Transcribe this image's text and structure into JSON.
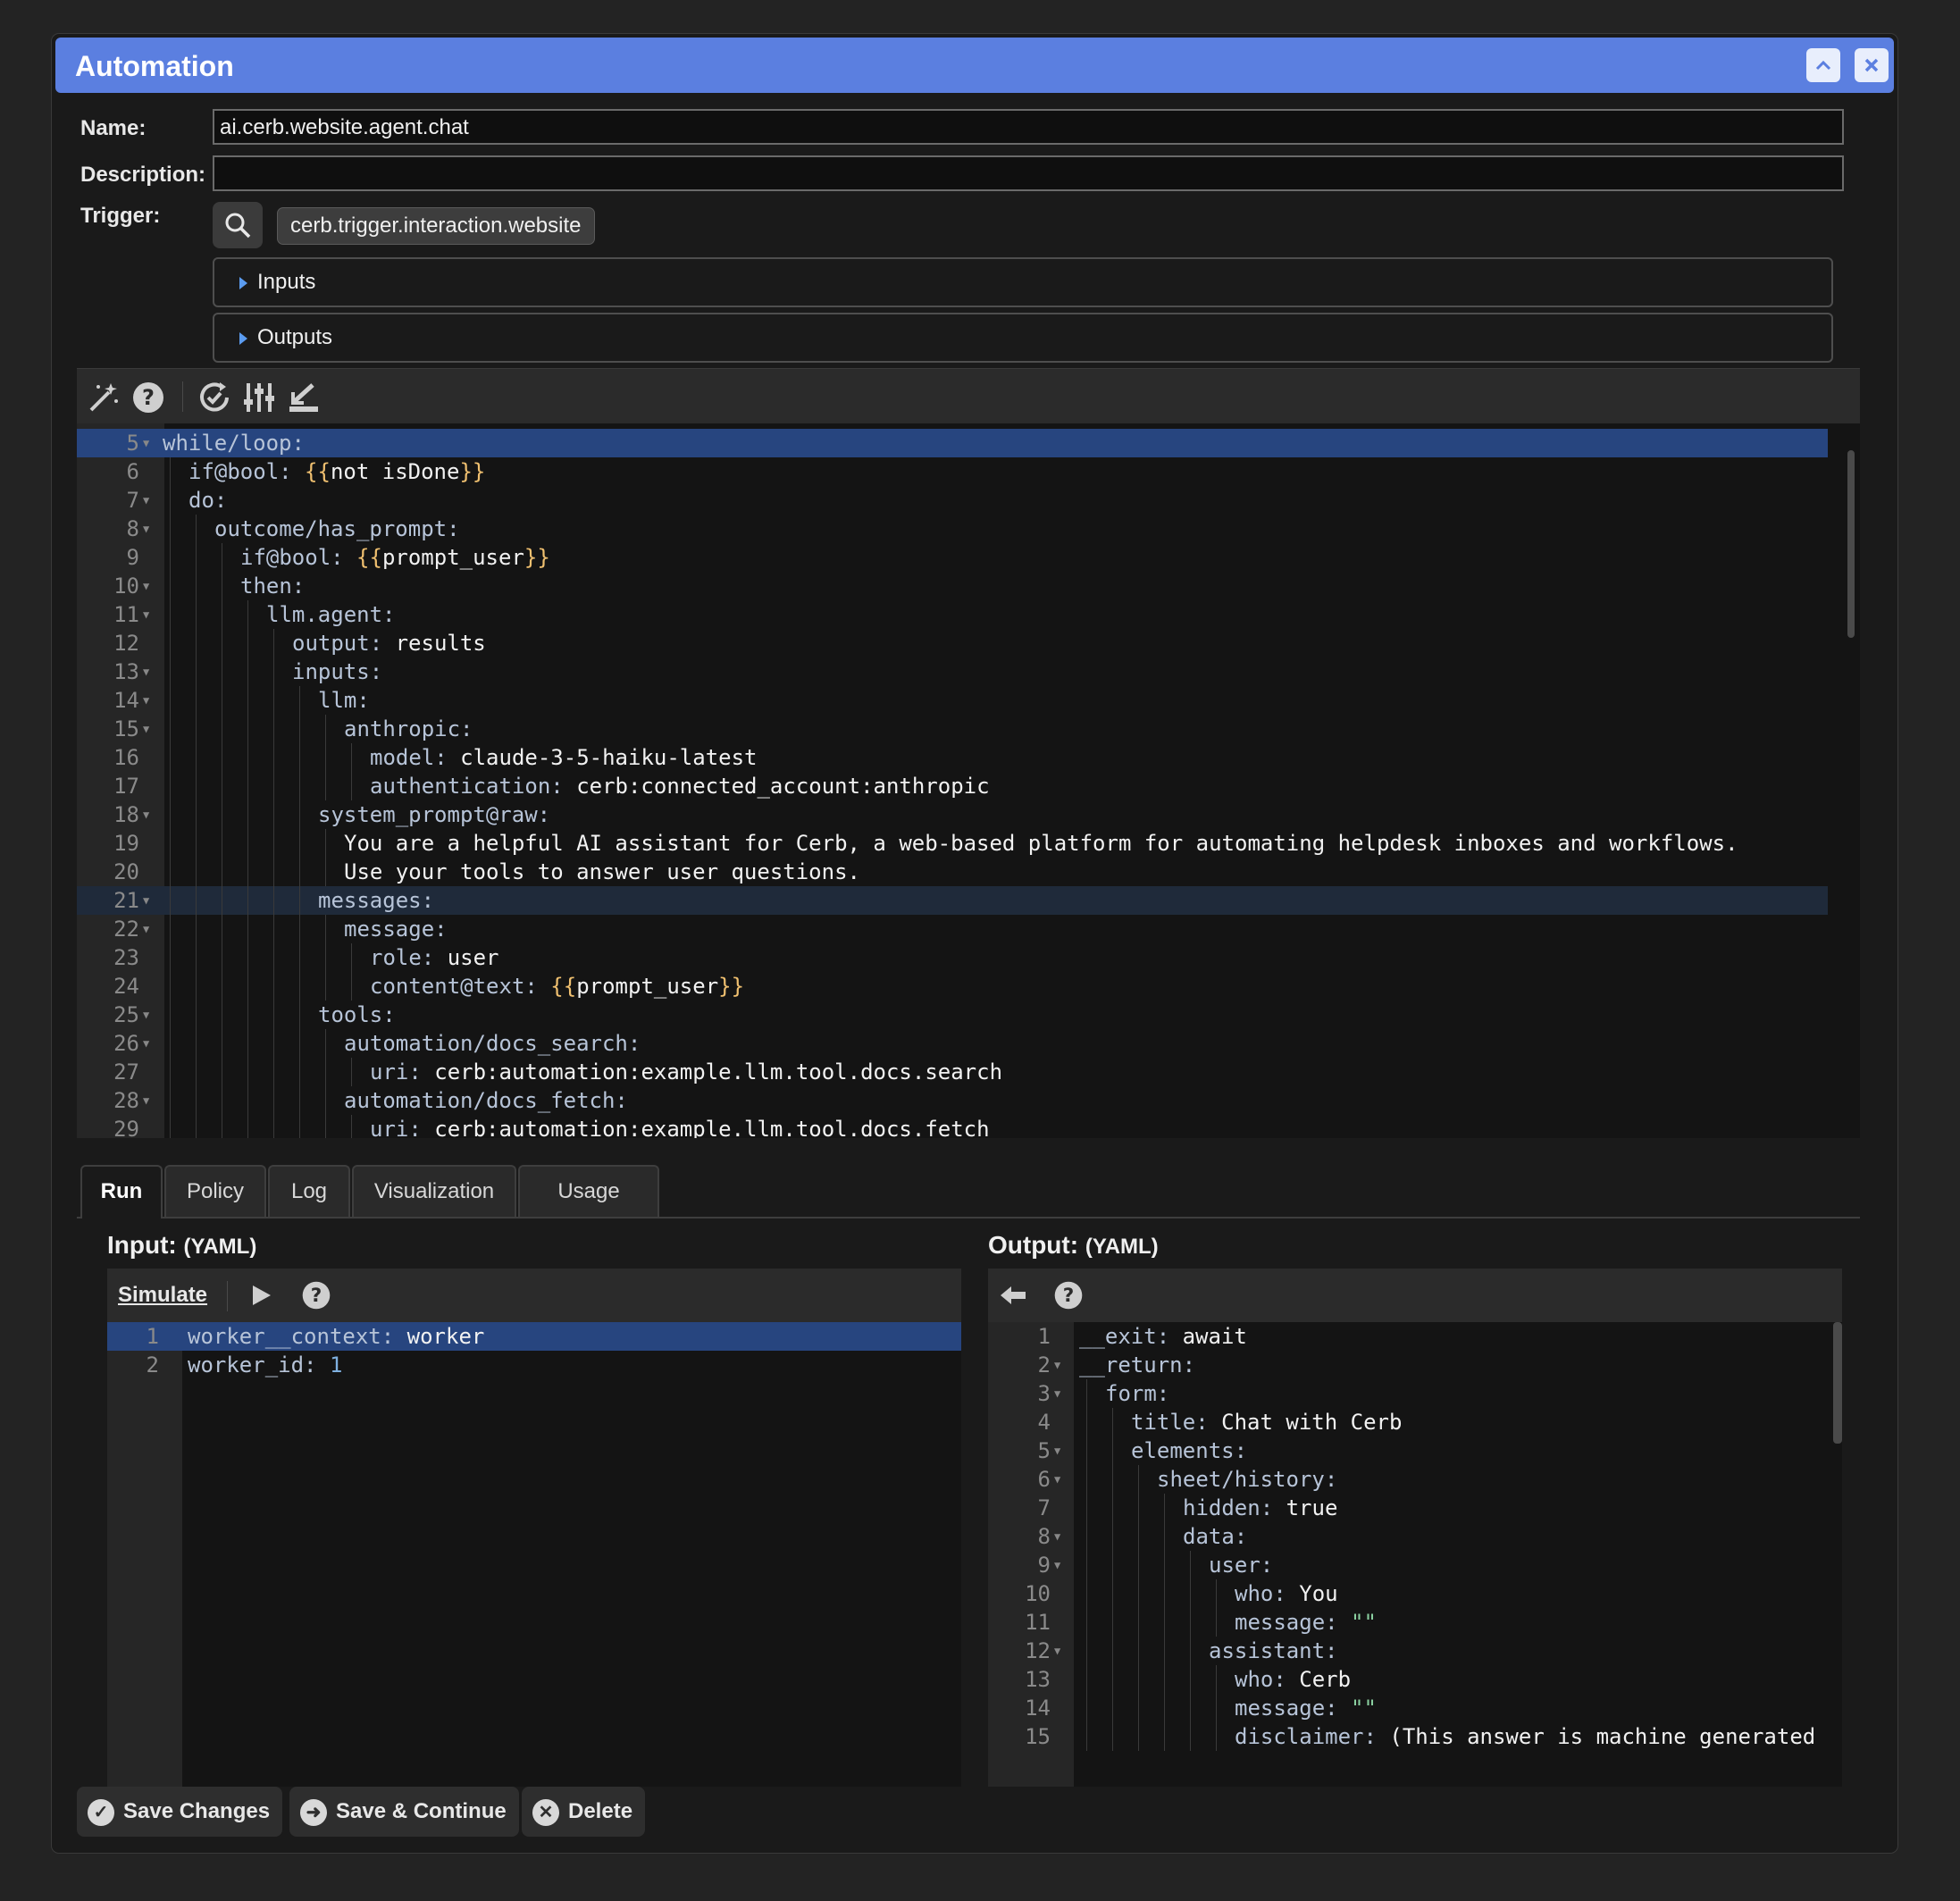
{
  "window": {
    "title": "Automation"
  },
  "form": {
    "name_label": "Name:",
    "name_value": "ai.cerb.website.agent.chat",
    "description_label": "Description:",
    "description_value": "",
    "trigger_label": "Trigger:",
    "trigger_value": "cerb.trigger.interaction.website",
    "inputs_label": "Inputs",
    "outputs_label": "Outputs"
  },
  "toolbar_icons": [
    "magic-wand-icon",
    "help-icon",
    "refresh-check-icon",
    "sliders-icon",
    "export-icon"
  ],
  "editor": {
    "lines": [
      {
        "n": "5",
        "fold": true,
        "indent": 0,
        "parts": [
          [
            "k",
            "while/loop:"
          ]
        ]
      },
      {
        "n": "6",
        "fold": false,
        "indent": 1,
        "parts": [
          [
            "k",
            "if@bool: "
          ],
          [
            "y",
            "{{"
          ],
          [
            "t",
            "not isDone"
          ],
          [
            "y",
            "}}"
          ]
        ]
      },
      {
        "n": "7",
        "fold": true,
        "indent": 1,
        "parts": [
          [
            "k",
            "do:"
          ]
        ]
      },
      {
        "n": "8",
        "fold": true,
        "indent": 2,
        "parts": [
          [
            "k",
            "outcome/has_prompt:"
          ]
        ]
      },
      {
        "n": "9",
        "fold": false,
        "indent": 3,
        "parts": [
          [
            "k",
            "if@bool: "
          ],
          [
            "y",
            "{{"
          ],
          [
            "t",
            "prompt_user"
          ],
          [
            "y",
            "}}"
          ]
        ]
      },
      {
        "n": "10",
        "fold": true,
        "indent": 3,
        "parts": [
          [
            "k",
            "then:"
          ]
        ]
      },
      {
        "n": "11",
        "fold": true,
        "indent": 4,
        "parts": [
          [
            "k",
            "llm.agent:"
          ]
        ]
      },
      {
        "n": "12",
        "fold": false,
        "indent": 5,
        "parts": [
          [
            "k",
            "output: "
          ],
          [
            "t",
            "results"
          ]
        ]
      },
      {
        "n": "13",
        "fold": true,
        "indent": 5,
        "parts": [
          [
            "k",
            "inputs:"
          ]
        ]
      },
      {
        "n": "14",
        "fold": true,
        "indent": 6,
        "parts": [
          [
            "k",
            "llm:"
          ]
        ]
      },
      {
        "n": "15",
        "fold": true,
        "indent": 7,
        "parts": [
          [
            "k",
            "anthropic:"
          ]
        ]
      },
      {
        "n": "16",
        "fold": false,
        "indent": 8,
        "parts": [
          [
            "k",
            "model: "
          ],
          [
            "t",
            "claude-3-5-haiku-latest"
          ]
        ]
      },
      {
        "n": "17",
        "fold": false,
        "indent": 8,
        "parts": [
          [
            "k",
            "authentication: "
          ],
          [
            "t",
            "cerb:connected_account:anthropic"
          ]
        ]
      },
      {
        "n": "18",
        "fold": true,
        "indent": 6,
        "parts": [
          [
            "k",
            "system_prompt@raw:"
          ]
        ]
      },
      {
        "n": "19",
        "fold": false,
        "indent": 7,
        "parts": [
          [
            "t",
            "You are a helpful AI assistant for Cerb, a web-based platform for automating helpdesk inboxes and workflows."
          ]
        ]
      },
      {
        "n": "20",
        "fold": false,
        "indent": 7,
        "parts": [
          [
            "t",
            "Use your tools to answer user questions."
          ]
        ]
      },
      {
        "n": "21",
        "fold": true,
        "indent": 6,
        "parts": [
          [
            "k",
            "messages:"
          ]
        ]
      },
      {
        "n": "22",
        "fold": true,
        "indent": 7,
        "parts": [
          [
            "k",
            "message:"
          ]
        ]
      },
      {
        "n": "23",
        "fold": false,
        "indent": 8,
        "parts": [
          [
            "k",
            "role: "
          ],
          [
            "t",
            "user"
          ]
        ]
      },
      {
        "n": "24",
        "fold": false,
        "indent": 8,
        "parts": [
          [
            "k",
            "content@text: "
          ],
          [
            "y",
            "{{"
          ],
          [
            "t",
            "prompt_user"
          ],
          [
            "y",
            "}}"
          ]
        ]
      },
      {
        "n": "25",
        "fold": true,
        "indent": 6,
        "parts": [
          [
            "k",
            "tools:"
          ]
        ]
      },
      {
        "n": "26",
        "fold": true,
        "indent": 7,
        "parts": [
          [
            "k",
            "automation/docs_search:"
          ]
        ]
      },
      {
        "n": "27",
        "fold": false,
        "indent": 8,
        "parts": [
          [
            "k",
            "uri: "
          ],
          [
            "t",
            "cerb:automation:example.llm.tool.docs.search"
          ]
        ]
      },
      {
        "n": "28",
        "fold": true,
        "indent": 7,
        "parts": [
          [
            "k",
            "automation/docs_fetch:"
          ]
        ]
      },
      {
        "n": "29",
        "fold": false,
        "indent": 8,
        "parts": [
          [
            "k",
            "uri: "
          ],
          [
            "t",
            "cerb:automation:example.llm.tool.docs.fetch"
          ]
        ]
      }
    ]
  },
  "tabs": [
    "Run",
    "Policy",
    "Log",
    "Visualization",
    "Usage"
  ],
  "input_pane": {
    "title": "Input:",
    "format": "(YAML)",
    "simulate_label": "Simulate",
    "lines": [
      {
        "n": "1",
        "parts": [
          [
            "k",
            "worker__context: "
          ],
          [
            "t",
            "worker"
          ]
        ]
      },
      {
        "n": "2",
        "parts": [
          [
            "k",
            "worker_id: "
          ],
          [
            "num",
            "1"
          ]
        ]
      }
    ]
  },
  "output_pane": {
    "title": "Output:",
    "format": "(YAML)",
    "lines": [
      {
        "n": "1",
        "fold": false,
        "indent": 0,
        "parts": [
          [
            "k",
            "__exit: "
          ],
          [
            "t",
            "await"
          ]
        ]
      },
      {
        "n": "2",
        "fold": true,
        "indent": 0,
        "parts": [
          [
            "k",
            "__return:"
          ]
        ]
      },
      {
        "n": "3",
        "fold": true,
        "indent": 1,
        "parts": [
          [
            "k",
            "form:"
          ]
        ]
      },
      {
        "n": "4",
        "fold": false,
        "indent": 2,
        "parts": [
          [
            "k",
            "title: "
          ],
          [
            "t",
            "Chat with Cerb"
          ]
        ]
      },
      {
        "n": "5",
        "fold": true,
        "indent": 2,
        "parts": [
          [
            "k",
            "elements:"
          ]
        ]
      },
      {
        "n": "6",
        "fold": true,
        "indent": 3,
        "parts": [
          [
            "k",
            "sheet/history:"
          ]
        ]
      },
      {
        "n": "7",
        "fold": false,
        "indent": 4,
        "parts": [
          [
            "k",
            "hidden: "
          ],
          [
            "t",
            "true"
          ]
        ]
      },
      {
        "n": "8",
        "fold": true,
        "indent": 4,
        "parts": [
          [
            "k",
            "data:"
          ]
        ]
      },
      {
        "n": "9",
        "fold": true,
        "indent": 5,
        "parts": [
          [
            "k",
            "user:"
          ]
        ]
      },
      {
        "n": "10",
        "fold": false,
        "indent": 6,
        "parts": [
          [
            "k",
            "who: "
          ],
          [
            "t",
            "You"
          ]
        ]
      },
      {
        "n": "11",
        "fold": false,
        "indent": 6,
        "parts": [
          [
            "k",
            "message: "
          ],
          [
            "s",
            "\"\""
          ]
        ]
      },
      {
        "n": "12",
        "fold": true,
        "indent": 5,
        "parts": [
          [
            "k",
            "assistant:"
          ]
        ]
      },
      {
        "n": "13",
        "fold": false,
        "indent": 6,
        "parts": [
          [
            "k",
            "who: "
          ],
          [
            "t",
            "Cerb"
          ]
        ]
      },
      {
        "n": "14",
        "fold": false,
        "indent": 6,
        "parts": [
          [
            "k",
            "message: "
          ],
          [
            "s",
            "\"\""
          ]
        ]
      },
      {
        "n": "15",
        "fold": false,
        "indent": 6,
        "parts": [
          [
            "k",
            "disclaimer: "
          ],
          [
            "t",
            "(This answer is machine generated"
          ]
        ]
      }
    ]
  },
  "footer": {
    "save_label": "Save Changes",
    "save_continue_label": "Save & Continue",
    "delete_label": "Delete"
  }
}
